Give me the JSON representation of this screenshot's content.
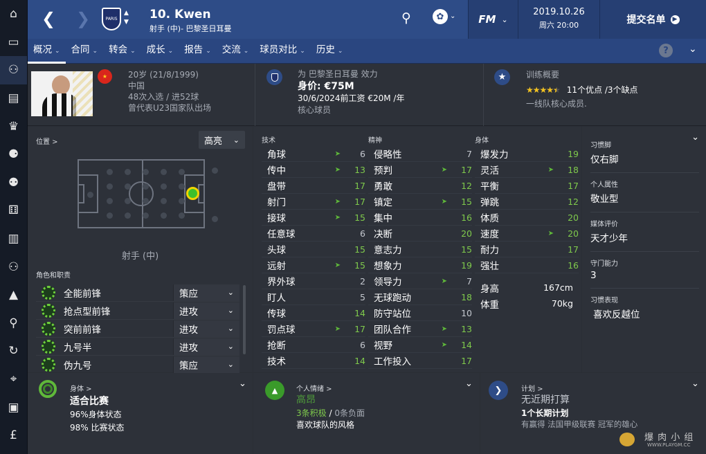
{
  "sidebar": {
    "items": [
      "home-icon",
      "inbox-icon",
      "squad-icon",
      "calendar-icon",
      "trophy-icon",
      "staff-icon",
      "u18-icon",
      "tactics-icon",
      "training-icon",
      "club-icon",
      "pitch-icon",
      "search-icon",
      "transfer-icon",
      "location-icon",
      "briefcase-icon",
      "finance-icon"
    ]
  },
  "topbar": {
    "player_name": "10. Kwen",
    "player_sub": "射手 (中)- 巴黎圣日耳曼",
    "club_badge_text": "PARIS",
    "fm_label": "FM",
    "date": "2019.10.26",
    "time": "周六 20:00",
    "submit": "提交名单"
  },
  "subnav": {
    "tabs": [
      "概况",
      "合同",
      "转会",
      "成长",
      "报告",
      "交流",
      "球员对比",
      "历史"
    ]
  },
  "header": {
    "age": "20岁 (21/8/1999)",
    "nation": "中国",
    "caps": "48次入选 / 进52球",
    "caps_note": "曾代表U23国家队出场",
    "club_line": "为 巴黎圣日耳曼 效力",
    "value": "身价: €75M",
    "contract": "30/6/2024前工资 €20M /年",
    "status": "核心球员",
    "training_title": "训练概要",
    "stars": 4.5,
    "stars_text": "★★★★★",
    "pros_cons": "11个优点 /3个缺点",
    "training_note": "一线队核心成员."
  },
  "position": {
    "title": "位置 >",
    "highlight": "高亮",
    "pos_label": "射手 (中)",
    "roles_title": "角色和职责"
  },
  "roles": [
    {
      "name": "全能前锋",
      "duty": "策应"
    },
    {
      "name": "抢点型前锋",
      "duty": "进攻"
    },
    {
      "name": "突前前锋",
      "duty": "进攻"
    },
    {
      "name": "九号半",
      "duty": "进攻"
    },
    {
      "name": "伪九号",
      "duty": "策应"
    }
  ],
  "attrs": {
    "tech_title": "技术",
    "mental_title": "精神",
    "physical_title": "身体",
    "tech": [
      {
        "name": "角球",
        "val": "6",
        "arrow": true
      },
      {
        "name": "传中",
        "val": "13",
        "arrow": true
      },
      {
        "name": "盘带",
        "val": "17",
        "arrow": false
      },
      {
        "name": "射门",
        "val": "17",
        "arrow": true
      },
      {
        "name": "接球",
        "val": "15",
        "arrow": true
      },
      {
        "name": "任意球",
        "val": "6",
        "arrow": false
      },
      {
        "name": "头球",
        "val": "15",
        "arrow": false
      },
      {
        "name": "远射",
        "val": "15",
        "arrow": true
      },
      {
        "name": "界外球",
        "val": "2",
        "arrow": false
      },
      {
        "name": "盯人",
        "val": "5",
        "arrow": false
      },
      {
        "name": "传球",
        "val": "14",
        "arrow": false
      },
      {
        "name": "罚点球",
        "val": "17",
        "arrow": true
      },
      {
        "name": "抢断",
        "val": "6",
        "arrow": false
      },
      {
        "name": "技术",
        "val": "14",
        "arrow": false
      }
    ],
    "mental": [
      {
        "name": "侵略性",
        "val": "7",
        "arrow": false
      },
      {
        "name": "预判",
        "val": "17",
        "arrow": true
      },
      {
        "name": "勇敢",
        "val": "12",
        "arrow": false
      },
      {
        "name": "镇定",
        "val": "15",
        "arrow": true
      },
      {
        "name": "集中",
        "val": "16",
        "arrow": false
      },
      {
        "name": "决断",
        "val": "20",
        "arrow": false
      },
      {
        "name": "意志力",
        "val": "15",
        "arrow": false
      },
      {
        "name": "想象力",
        "val": "19",
        "arrow": false
      },
      {
        "name": "领导力",
        "val": "7",
        "arrow": true
      },
      {
        "name": "无球跑动",
        "val": "18",
        "arrow": false
      },
      {
        "name": "防守站位",
        "val": "10",
        "arrow": false
      },
      {
        "name": "团队合作",
        "val": "13",
        "arrow": true
      },
      {
        "name": "视野",
        "val": "14",
        "arrow": true
      },
      {
        "name": "工作投入",
        "val": "17",
        "arrow": false
      }
    ],
    "physical": [
      {
        "name": "爆发力",
        "val": "19",
        "arrow": false
      },
      {
        "name": "灵活",
        "val": "18",
        "arrow": true
      },
      {
        "name": "平衡",
        "val": "17",
        "arrow": false
      },
      {
        "name": "弹跳",
        "val": "12",
        "arrow": false
      },
      {
        "name": "体质",
        "val": "20",
        "arrow": false
      },
      {
        "name": "速度",
        "val": "20",
        "arrow": true
      },
      {
        "name": "耐力",
        "val": "17",
        "arrow": false
      },
      {
        "name": "强壮",
        "val": "16",
        "arrow": false
      }
    ],
    "height_label": "身高",
    "height": "167cm",
    "weight_label": "体重",
    "weight": "70kg"
  },
  "right": {
    "foot_title": "习惯脚",
    "foot": "仅右脚",
    "pers_title": "个人属性",
    "pers": "敬业型",
    "media_title": "媒体评价",
    "media": "天才少年",
    "keeper_title": "守门能力",
    "keeper": "3",
    "habits_title": "习惯表现",
    "habits": "喜欢反越位"
  },
  "bottom": {
    "body_title": "身体 >",
    "body_state": "适合比赛",
    "body_pct": "96%身体状态",
    "body_fit": "98% 比赛状态",
    "mood_title": "个人情绪 >",
    "mood": "高昂",
    "mood_pos": "3条积极",
    "mood_sep": " / ",
    "mood_neg": "0条负面",
    "mood_note": "喜欢球队的风格",
    "plan_title": "计划 >",
    "plan": "无近期打算",
    "plan_long": "1个长期计划",
    "plan_note": "有赢得 法国甲级联赛 冠军的雄心"
  },
  "watermark": "爆 肉 小 组",
  "watermark_url": "WWW.PLAYGM.CC",
  "colors": {
    "topbar": "#2e4c87",
    "accent_green": "#7fca4c",
    "panel": "#2d3139"
  }
}
